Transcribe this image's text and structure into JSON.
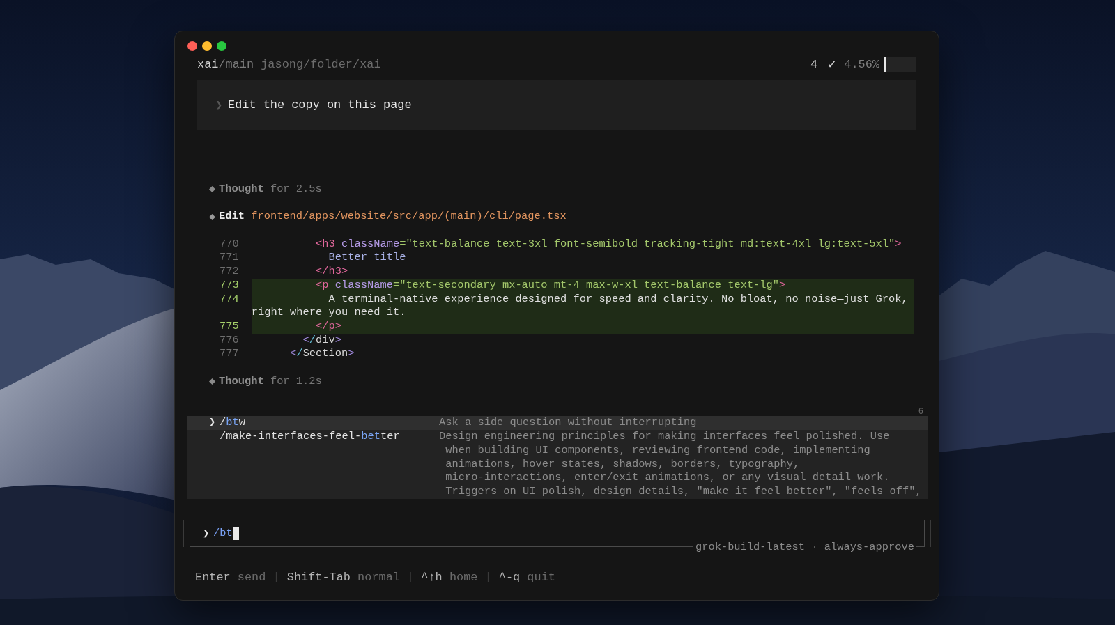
{
  "window": {
    "controls": [
      {
        "kind": "close"
      },
      {
        "kind": "minimize"
      },
      {
        "kind": "maximize"
      }
    ]
  },
  "header": {
    "repo": "xai",
    "branch": "/main",
    "path": "jasong/folder/xai",
    "count": "4",
    "check": "✓",
    "context": {
      "reading": "4.56%",
      "level": 0.0456
    }
  },
  "prompt": {
    "chevron": "❯",
    "text": "Edit the copy on this page"
  },
  "activity": [
    {
      "kind": "thought",
      "label": "Thought",
      "detail": "for 2.5s"
    },
    {
      "kind": "edit",
      "label": "Edit",
      "detail": "frontend/apps/website/src/app/(main)/cli/page.tsx",
      "lines": [
        {
          "number": "770",
          "changed": false,
          "tokens": [
            {
              "kind": "tag",
              "text": "          <h3"
            },
            {
              "kind": "attr",
              "text": " className"
            },
            {
              "kind": "string",
              "text": "=\"text-balance text-3xl font-semibold tracking-tight md:text-4xl lg:text-5xl\""
            },
            {
              "kind": "tag",
              "text": ">"
            }
          ]
        },
        {
          "number": "771",
          "changed": false,
          "tokens": [
            {
              "kind": "text",
              "text": "            Better title"
            }
          ]
        },
        {
          "number": "772",
          "changed": false,
          "tokens": [
            {
              "kind": "tag",
              "text": "          </h3>"
            }
          ]
        },
        {
          "number": "773",
          "changed": true,
          "tokens": [
            {
              "kind": "tag",
              "text": "          <p"
            },
            {
              "kind": "attr",
              "text": " className"
            },
            {
              "kind": "string",
              "text": "=\"text-secondary mx-auto mt-4 max-w-xl text-balance text-lg\""
            },
            {
              "kind": "tag",
              "text": ">"
            }
          ]
        },
        {
          "number": "774",
          "changed": true,
          "tokens": [
            {
              "kind": "plain",
              "text": "            A terminal-native experience designed for speed and clarity. No bloat, no noise—just Grok, right where you need it."
            }
          ]
        },
        {
          "number": "775",
          "changed": true,
          "tokens": [
            {
              "kind": "tag",
              "text": "          </p>"
            }
          ]
        },
        {
          "number": "776",
          "changed": false,
          "tokens": [
            {
              "kind": "bracket",
              "text": "        <"
            },
            {
              "kind": "slash",
              "text": "/"
            },
            {
              "kind": "name",
              "text": "div"
            },
            {
              "kind": "bracket",
              "text": ">"
            }
          ]
        },
        {
          "number": "777",
          "changed": false,
          "tokens": [
            {
              "kind": "bracket",
              "text": "      <"
            },
            {
              "kind": "slash",
              "text": "/"
            },
            {
              "kind": "name",
              "text": "Section"
            },
            {
              "kind": "bracket",
              "text": ">"
            }
          ]
        }
      ]
    },
    {
      "kind": "thought",
      "label": "Thought",
      "detail": "for 1.2s"
    }
  ],
  "suggestions": {
    "count": "6",
    "items": [
      {
        "selected": true,
        "marker": "❯",
        "command": [
          {
            "text": "/",
            "match": false
          },
          {
            "text": "bt",
            "match": true
          },
          {
            "text": "w",
            "match": false
          }
        ],
        "description": [
          "Ask a side question without interrupting"
        ]
      },
      {
        "selected": false,
        "command": [
          {
            "text": "/make-interfaces-feel-",
            "match": false
          },
          {
            "text": "bet",
            "match": true
          },
          {
            "text": "ter",
            "match": false
          }
        ],
        "description": [
          "Design engineering principles for making interfaces feel polished. Use",
          "when building UI components, reviewing frontend code, implementing",
          "animations, hover states, shadows, borders, typography,",
          "micro-interactions, enter/exit animations, or any visual detail work.",
          "Triggers on UI polish, design details, \"make it feel better\", \"feels off\","
        ]
      }
    ]
  },
  "input": {
    "chevron": "❯",
    "value": "/bt",
    "model": "grok-build-latest",
    "separator": "·",
    "mode": "always-approve"
  },
  "footer": {
    "hints": [
      {
        "key": "Enter",
        "action": "send"
      },
      {
        "key": "Shift-Tab",
        "action": "normal"
      },
      {
        "key": "^↑h",
        "action": "home"
      },
      {
        "key": "^-q",
        "action": "quit"
      }
    ],
    "separators": [
      "|",
      "|",
      "|"
    ]
  }
}
